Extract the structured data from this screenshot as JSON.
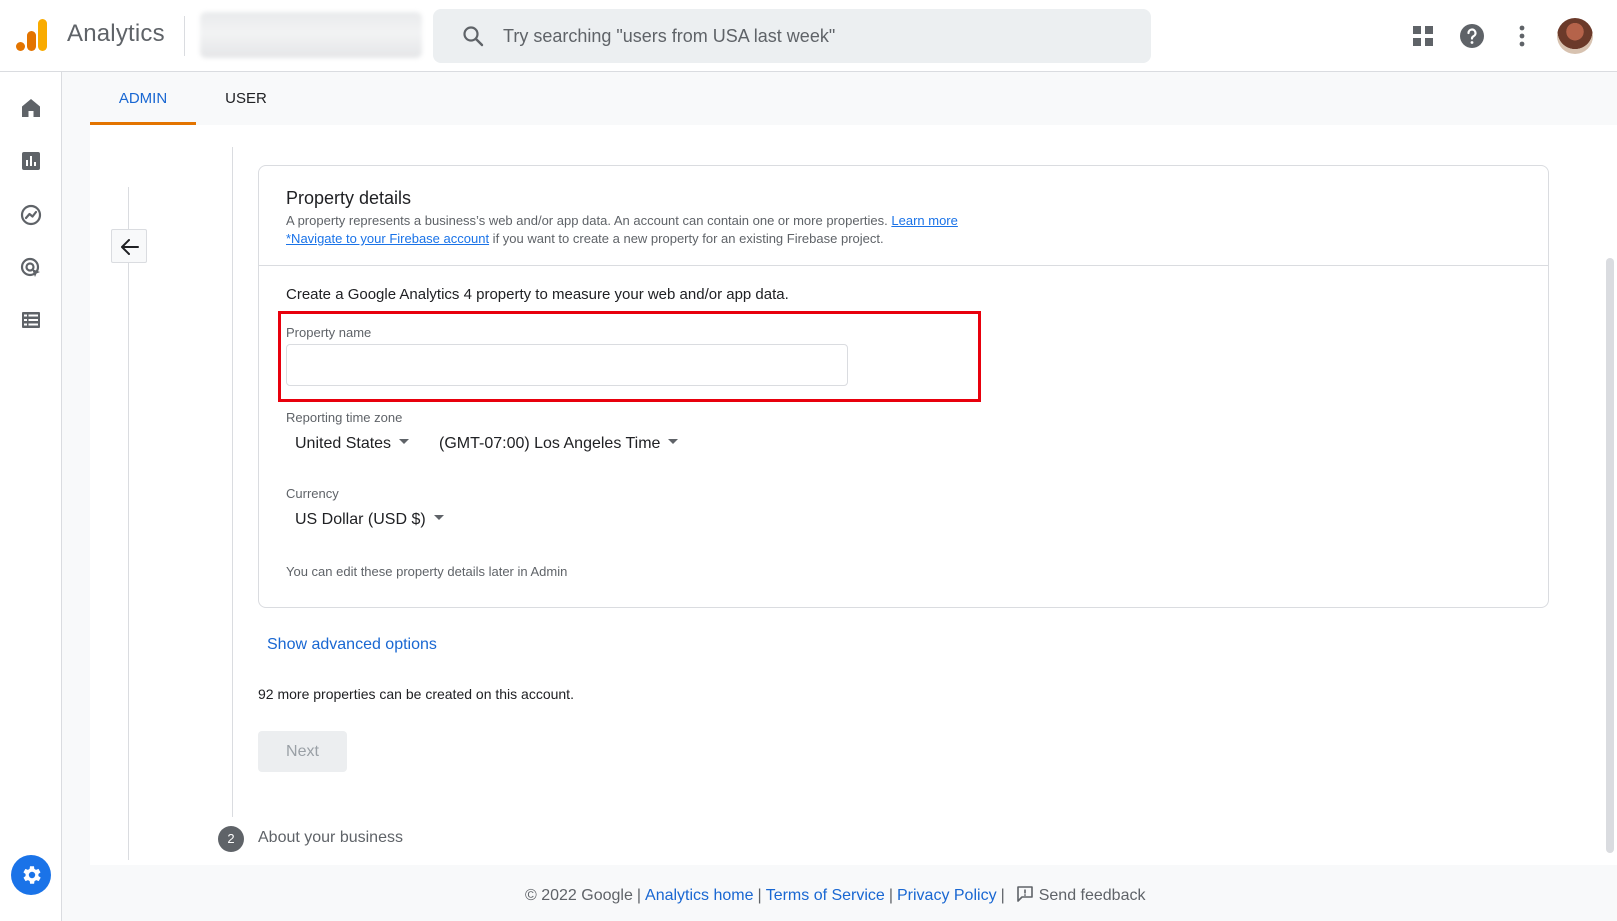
{
  "app": {
    "title": "Analytics"
  },
  "search": {
    "placeholder": "Try searching \"users from USA last week\""
  },
  "topbar_icons": [
    "apps-grid-icon",
    "help-icon",
    "more-vert-icon"
  ],
  "nav_icons": [
    "home-icon",
    "reports-icon",
    "explore-icon",
    "advertising-icon",
    "configure-icon",
    "admin-gear-icon"
  ],
  "tabs": [
    {
      "label": "ADMIN",
      "active": true
    },
    {
      "label": "USER",
      "active": false
    }
  ],
  "card": {
    "title": "Property details",
    "desc_line1": "A property represents a business’s web and/or app data. An account can contain one or more properties.",
    "learn_more": "Learn more",
    "firebase_link": "*Navigate to your Firebase account",
    "desc_line2_rest": " if you want to create a new property for an existing Firebase project."
  },
  "form": {
    "intro": "Create a Google Analytics 4 property to measure your web and/or app data.",
    "property_name_label": "Property name",
    "property_name_value": "",
    "timezone_label": "Reporting time zone",
    "country": "United States",
    "timezone": "(GMT-07:00) Los Angeles Time",
    "currency_label": "Currency",
    "currency": "US Dollar (USD $)",
    "note": "You can edit these property details later in Admin"
  },
  "advanced_options": "Show advanced options",
  "remaining_text": "92 more properties can be created on this account.",
  "next_label": "Next",
  "step2": {
    "number": "2",
    "label": "About your business"
  },
  "footer": {
    "copyright": "© 2022 Google",
    "analytics_home": "Analytics home",
    "terms": "Terms of Service",
    "privacy": "Privacy Policy",
    "feedback": "Send feedback"
  },
  "colors": {
    "accent": "#1a73e8",
    "tab_indicator": "#e37400",
    "highlight_box": "#e8000d"
  }
}
